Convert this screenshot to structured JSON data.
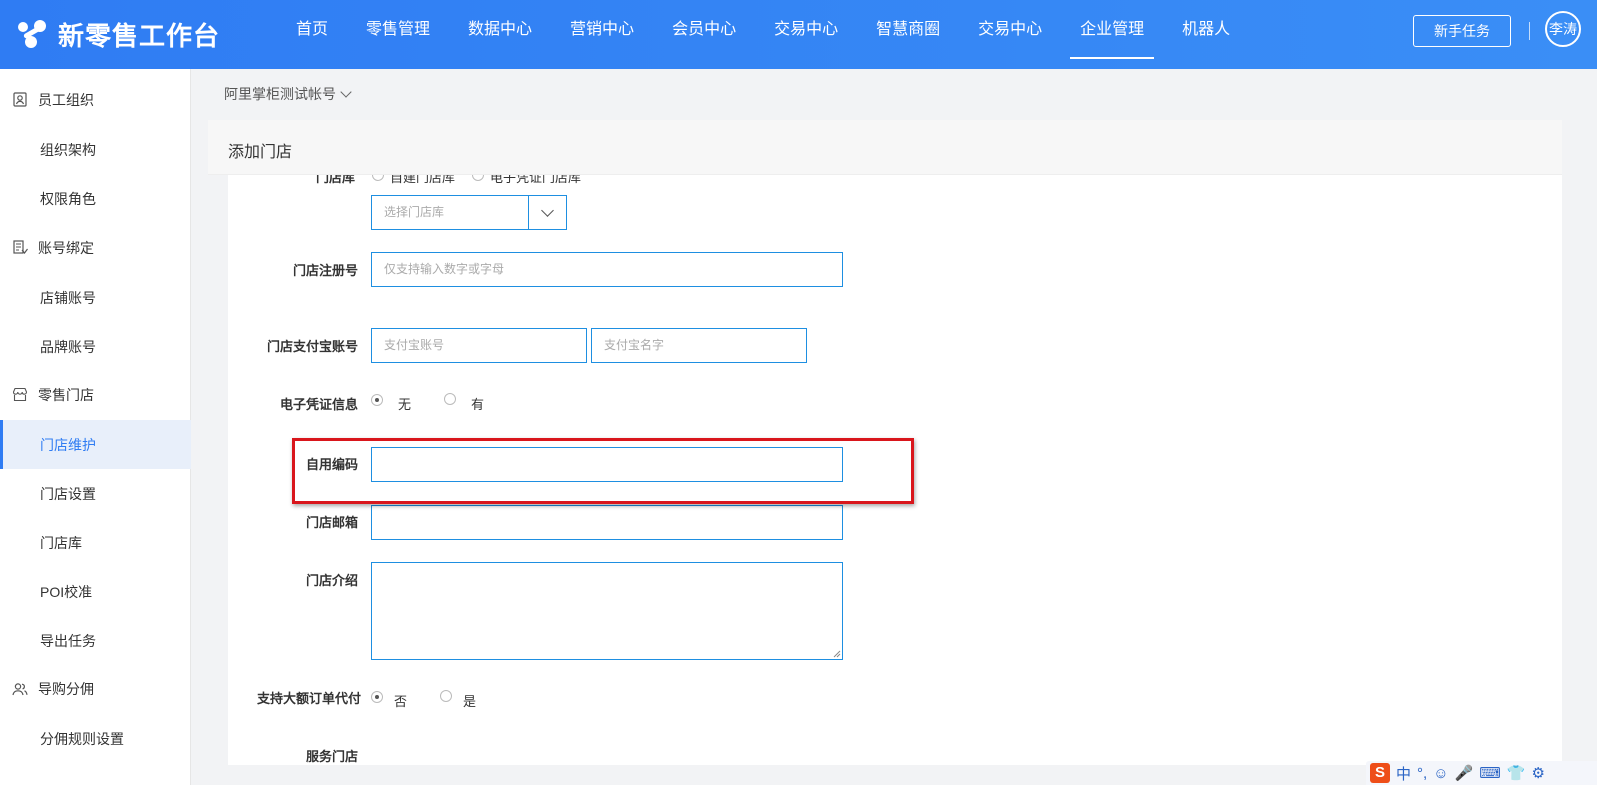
{
  "header": {
    "brand": "新零售工作台",
    "nav": [
      "首页",
      "零售管理",
      "数据中心",
      "营销中心",
      "会员中心",
      "交易中心",
      "智慧商圈",
      "交易中心",
      "企业管理",
      "机器人"
    ],
    "active_nav": "企业管理",
    "task_button": "新手任务",
    "user": "李涛"
  },
  "sidebar": {
    "items": [
      {
        "label": "员工组织",
        "type": "group",
        "icon": "person-card-icon"
      },
      {
        "label": "组织架构",
        "type": "sub"
      },
      {
        "label": "权限角色",
        "type": "sub"
      },
      {
        "label": "账号绑定",
        "type": "group",
        "icon": "account-binding-icon"
      },
      {
        "label": "店铺账号",
        "type": "sub"
      },
      {
        "label": "品牌账号",
        "type": "sub"
      },
      {
        "label": "零售门店",
        "type": "group",
        "icon": "store-icon"
      },
      {
        "label": "门店维护",
        "type": "sub",
        "active": true
      },
      {
        "label": "门店设置",
        "type": "sub"
      },
      {
        "label": "门店库",
        "type": "sub"
      },
      {
        "label": "POI校准",
        "type": "sub"
      },
      {
        "label": "导出任务",
        "type": "sub"
      },
      {
        "label": "导购分佣",
        "type": "group",
        "icon": "people-icon"
      },
      {
        "label": "分佣规则设置",
        "type": "sub"
      }
    ]
  },
  "account": "阿里掌柜测试帐号",
  "panel": {
    "title": "添加门店"
  },
  "form": {
    "cut_top": {
      "label": "门店库",
      "option1": "自建门店库",
      "option2": "电子凭证门店库"
    },
    "store_lib_placeholder": "选择门店库",
    "reg_label": "门店注册号",
    "reg_placeholder": "仅支持输入数字或字母",
    "alipay_label": "门店支付宝账号",
    "alipay_account_placeholder": "支付宝账号",
    "alipay_name_placeholder": "支付宝名字",
    "voucher_label": "电子凭证信息",
    "voucher_opt_no": "无",
    "voucher_opt_yes": "有",
    "code_label": "自用编码",
    "email_label": "门店邮箱",
    "intro_label": "门店介绍",
    "bigpay_label": "支持大额订单代付",
    "bigpay_opt_no": "否",
    "bigpay_opt_yes": "是",
    "cut_bottom": "服务门店"
  },
  "ime": [
    "S",
    "中",
    "°,",
    "☺",
    "🎤",
    "⌨",
    "👕",
    "⚙"
  ]
}
